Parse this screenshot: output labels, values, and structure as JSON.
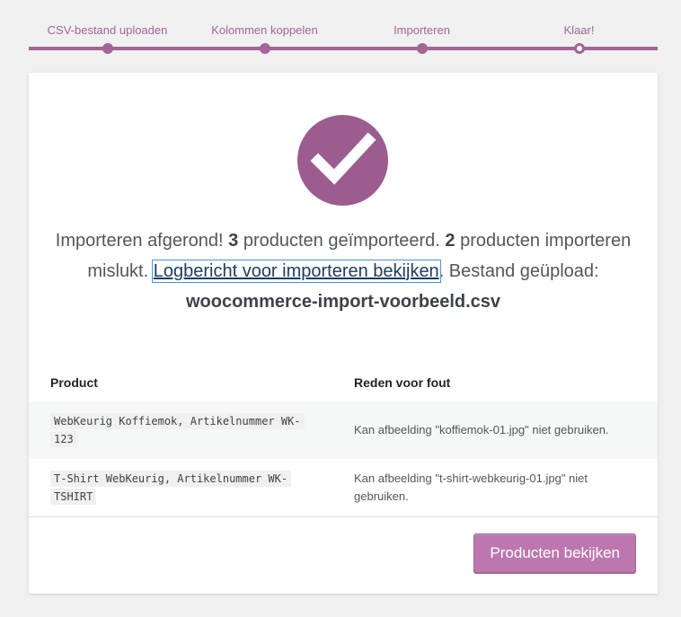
{
  "colors": {
    "accent": "#a46497",
    "check_circle": "#9b5c8f",
    "button_bg": "#bb77ae",
    "link": "#1d3b5e"
  },
  "steps": [
    {
      "label": "CSV-bestand uploaden",
      "state": "done"
    },
    {
      "label": "Kolommen koppelen",
      "state": "done"
    },
    {
      "label": "Importeren",
      "state": "done"
    },
    {
      "label": "Klaar!",
      "state": "current"
    }
  ],
  "result": {
    "icon": "checkmark-icon",
    "text_1": "Importeren afgerond! ",
    "imported_count": "3",
    "text_2": " producten geïmporteerd. ",
    "failed_count": "2",
    "text_3": " producten importeren mislukt. ",
    "log_link": "Logbericht voor importeren bekijken",
    "text_4": ". Bestand geüpload: ",
    "filename": "woocommerce-import-voorbeeld.csv"
  },
  "errors_table": {
    "headers": {
      "product": "Product",
      "reason": "Reden voor fout"
    },
    "rows": [
      {
        "product": "WebKeurig Koffiemok, Artikelnummer WK-123",
        "reason": "Kan afbeelding \"koffiemok-01.jpg\" niet gebruiken."
      },
      {
        "product": "T-Shirt WebKeurig, Artikelnummer WK-TSHIRT",
        "reason": "Kan afbeelding \"t-shirt-webkeurig-01.jpg\" niet gebruiken."
      }
    ]
  },
  "actions": {
    "view_products": "Producten bekijken"
  }
}
